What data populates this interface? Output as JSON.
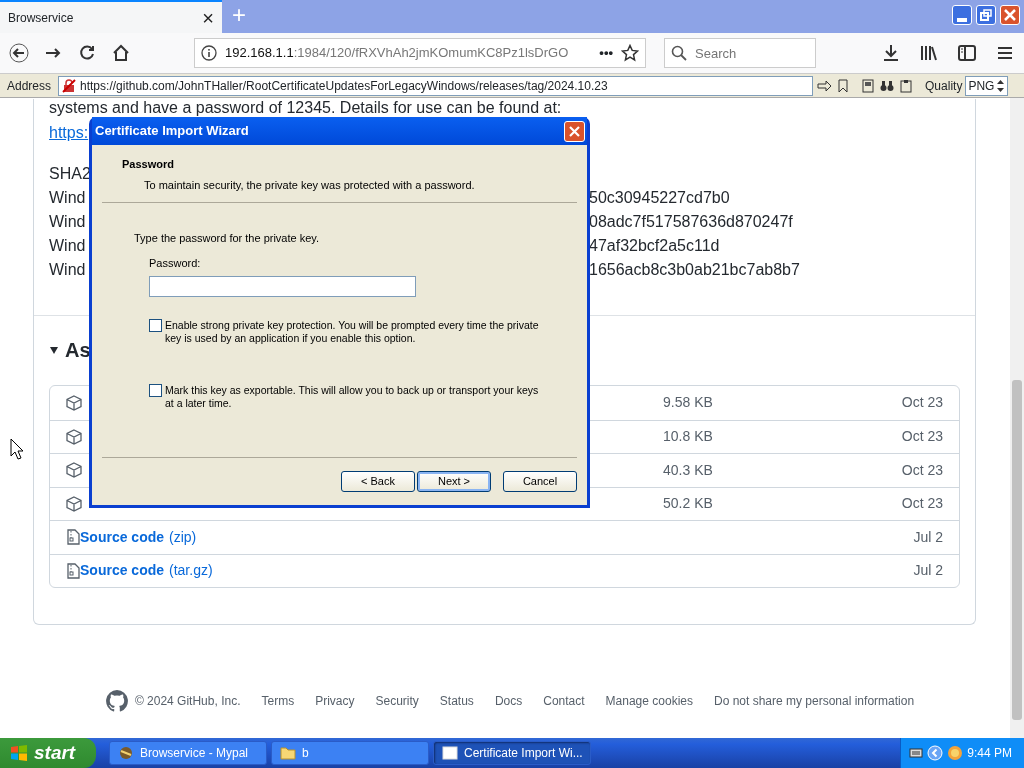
{
  "browser": {
    "tab": {
      "title": "Browservice",
      "close": "×",
      "selected": true
    },
    "new_tab": "+",
    "url": {
      "host": "192.168.1.1",
      "rest": ":1984/120/fRXVhAh2jmKOmumKC8Pz1lsDrGO"
    },
    "more": "•••",
    "search": {
      "placeholder": "Search"
    }
  },
  "address_bar": {
    "label": "Address",
    "url": "https://github.com/JohnTHaller/RootCertificateUpdatesForLegacyWindows/releases/tag/2024.10.23",
    "quality_label": "Quality",
    "quality": "PNG"
  },
  "page": {
    "intro_line": "systems and have a password of 12345. Details for use can be found at:",
    "link": "https:",
    "sha_label": "SHA2",
    "hash_lines": [
      {
        "label": "Wind",
        "hash": "50c30945227cd7b0"
      },
      {
        "label": "Wind",
        "hash": "08adc7f517587636d870247f"
      },
      {
        "label": "Wind",
        "hash": "47af32bcf2a5c11d"
      },
      {
        "label": "Wind",
        "hash": "1656acb8c3b0ab21bc7ab8b7"
      }
    ],
    "assets_heading": "As",
    "assets": [
      {
        "kind": "package",
        "size": "9.58 KB",
        "date": "Oct 23"
      },
      {
        "kind": "package",
        "size": "10.8 KB",
        "date": "Oct 23"
      },
      {
        "kind": "package",
        "size": "40.3 KB",
        "date": "Oct 23"
      },
      {
        "kind": "package",
        "size": "50.2 KB",
        "date": "Oct 23"
      },
      {
        "kind": "source",
        "name": "Source code",
        "format": "(zip)",
        "date": "Jul 2"
      },
      {
        "kind": "source",
        "name": "Source code",
        "format": "(tar.gz)",
        "date": "Jul 2"
      }
    ]
  },
  "footer": {
    "copyright": "© 2024 GitHub, Inc.",
    "links": [
      "Terms",
      "Privacy",
      "Security",
      "Status",
      "Docs",
      "Contact",
      "Manage cookies",
      "Do not share my personal information"
    ]
  },
  "dialog": {
    "title": "Certificate Import Wizard",
    "heading": "Password",
    "subheading": "To maintain security, the private key was protected with a password.",
    "prompt": "Type the password for the private key.",
    "password_label": "Password:",
    "options": [
      {
        "label": "Enable strong private key protection. You will be prompted every time the private key is used by an application if you enable this option.",
        "checked": false
      },
      {
        "label": "Mark this key as exportable. This will allow you to back up or transport your keys at a later time.",
        "checked": false
      }
    ],
    "buttons": [
      {
        "label": "< Back",
        "default": false
      },
      {
        "label": "Next >",
        "default": true
      },
      {
        "label": "Cancel",
        "default": false
      }
    ]
  },
  "taskbar": {
    "start": "start",
    "tasks": [
      {
        "label": "Browservice - Mypal",
        "selected": false
      },
      {
        "label": "b",
        "selected": false
      },
      {
        "label": "Certificate Import Wi...",
        "selected": true
      }
    ],
    "clock": "9:44 PM"
  }
}
